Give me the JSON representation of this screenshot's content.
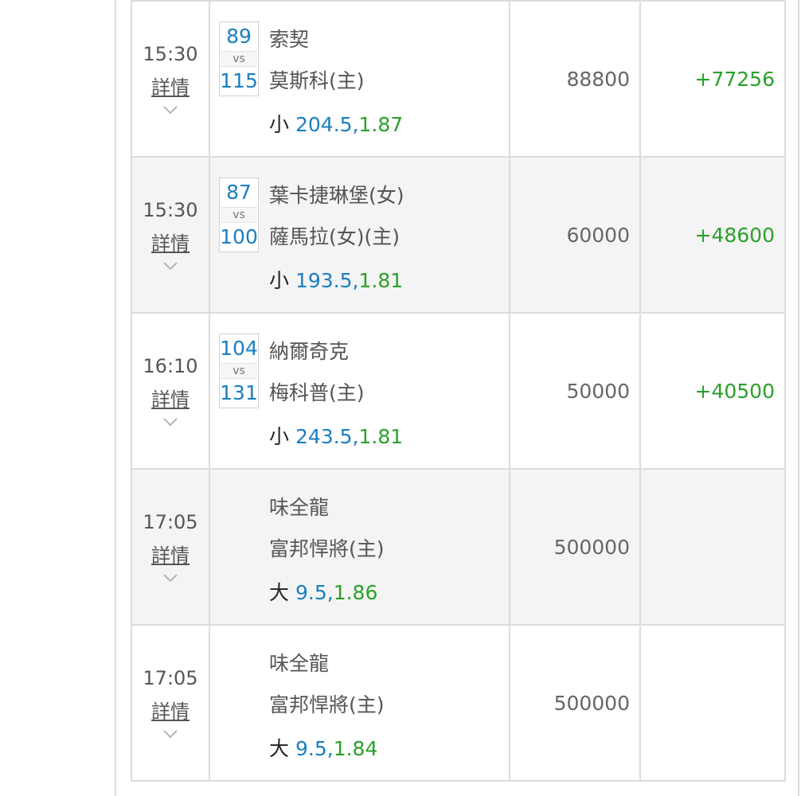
{
  "rows": [
    {
      "time": "15:30",
      "detail": "詳情",
      "score": {
        "home": "89",
        "vs": "vs",
        "away": "115"
      },
      "home_team": "索契",
      "away_team": "莫斯科(主)",
      "pick": {
        "side": "小",
        "line": "204.5,",
        "odds": "1.87"
      },
      "stake": "88800",
      "result": "+77256"
    },
    {
      "time": "15:30",
      "detail": "詳情",
      "score": {
        "home": "87",
        "vs": "vs",
        "away": "100"
      },
      "home_team": "葉卡捷琳堡(女)",
      "away_team": "薩馬拉(女)(主)",
      "pick": {
        "side": "小",
        "line": "193.5,",
        "odds": "1.81"
      },
      "stake": "60000",
      "result": "+48600"
    },
    {
      "time": "16:10",
      "detail": "詳情",
      "score": {
        "home": "104",
        "vs": "vs",
        "away": "131"
      },
      "home_team": "納爾奇克",
      "away_team": "梅科普(主)",
      "pick": {
        "side": "小",
        "line": "243.5,",
        "odds": "1.81"
      },
      "stake": "50000",
      "result": "+40500"
    },
    {
      "time": "17:05",
      "detail": "詳情",
      "home_team": "味全龍",
      "away_team": "富邦悍將(主)",
      "pick": {
        "side": "大",
        "line": "9.5,",
        "odds": "1.86"
      },
      "stake": "500000",
      "result": ""
    },
    {
      "time": "17:05",
      "detail": "詳情",
      "home_team": "味全龍",
      "away_team": "富邦悍將(主)",
      "pick": {
        "side": "大",
        "line": "9.5,",
        "odds": "1.84"
      },
      "stake": "500000",
      "result": ""
    }
  ],
  "icons": {
    "expand": "chevron-down-icon"
  },
  "colors": {
    "link_blue": "#1a7fc1",
    "odds_green": "#2aa02a",
    "border": "#dcdcdc",
    "row_shade": "#f4f4f4"
  }
}
